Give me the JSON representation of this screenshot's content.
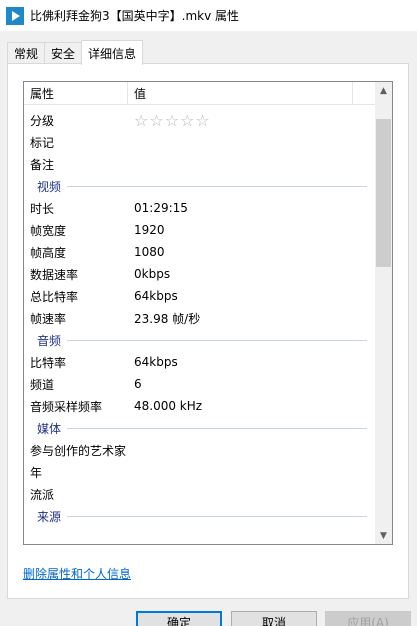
{
  "window": {
    "title": "比佛利拜金狗3【国英中字】.mkv 属性"
  },
  "tabs": [
    {
      "label": "常规"
    },
    {
      "label": "安全"
    },
    {
      "label": "详细信息"
    }
  ],
  "table": {
    "col_property": "属性",
    "col_value": "值",
    "rating_stars": "☆☆☆☆☆",
    "rating": 0,
    "rows_top": [
      {
        "key": "分级",
        "value": ""
      },
      {
        "key": "标记",
        "value": ""
      },
      {
        "key": "备注",
        "value": ""
      }
    ],
    "groups": [
      {
        "label": "视频",
        "rows": [
          {
            "key": "时长",
            "value": "01:29:15"
          },
          {
            "key": "帧宽度",
            "value": "1920"
          },
          {
            "key": "帧高度",
            "value": "1080"
          },
          {
            "key": "数据速率",
            "value": "0kbps"
          },
          {
            "key": "总比特率",
            "value": "64kbps"
          },
          {
            "key": "帧速率",
            "value": "23.98 帧/秒"
          }
        ]
      },
      {
        "label": "音频",
        "rows": [
          {
            "key": "比特率",
            "value": "64kbps"
          },
          {
            "key": "频道",
            "value": "6"
          },
          {
            "key": "音频采样频率",
            "value": "48.000 kHz"
          }
        ]
      },
      {
        "label": "媒体",
        "rows": [
          {
            "key": "参与创作的艺术家",
            "value": ""
          },
          {
            "key": "年",
            "value": ""
          },
          {
            "key": "流派",
            "value": ""
          }
        ]
      },
      {
        "label": "来源",
        "rows": []
      }
    ]
  },
  "link": {
    "label": "删除属性和个人信息"
  },
  "buttons": {
    "ok": "确定",
    "cancel": "取消",
    "apply": "应用(A)"
  },
  "colors": {
    "accent": "#0078d7",
    "group_label": "#1e3287",
    "link": "#0066cc"
  }
}
